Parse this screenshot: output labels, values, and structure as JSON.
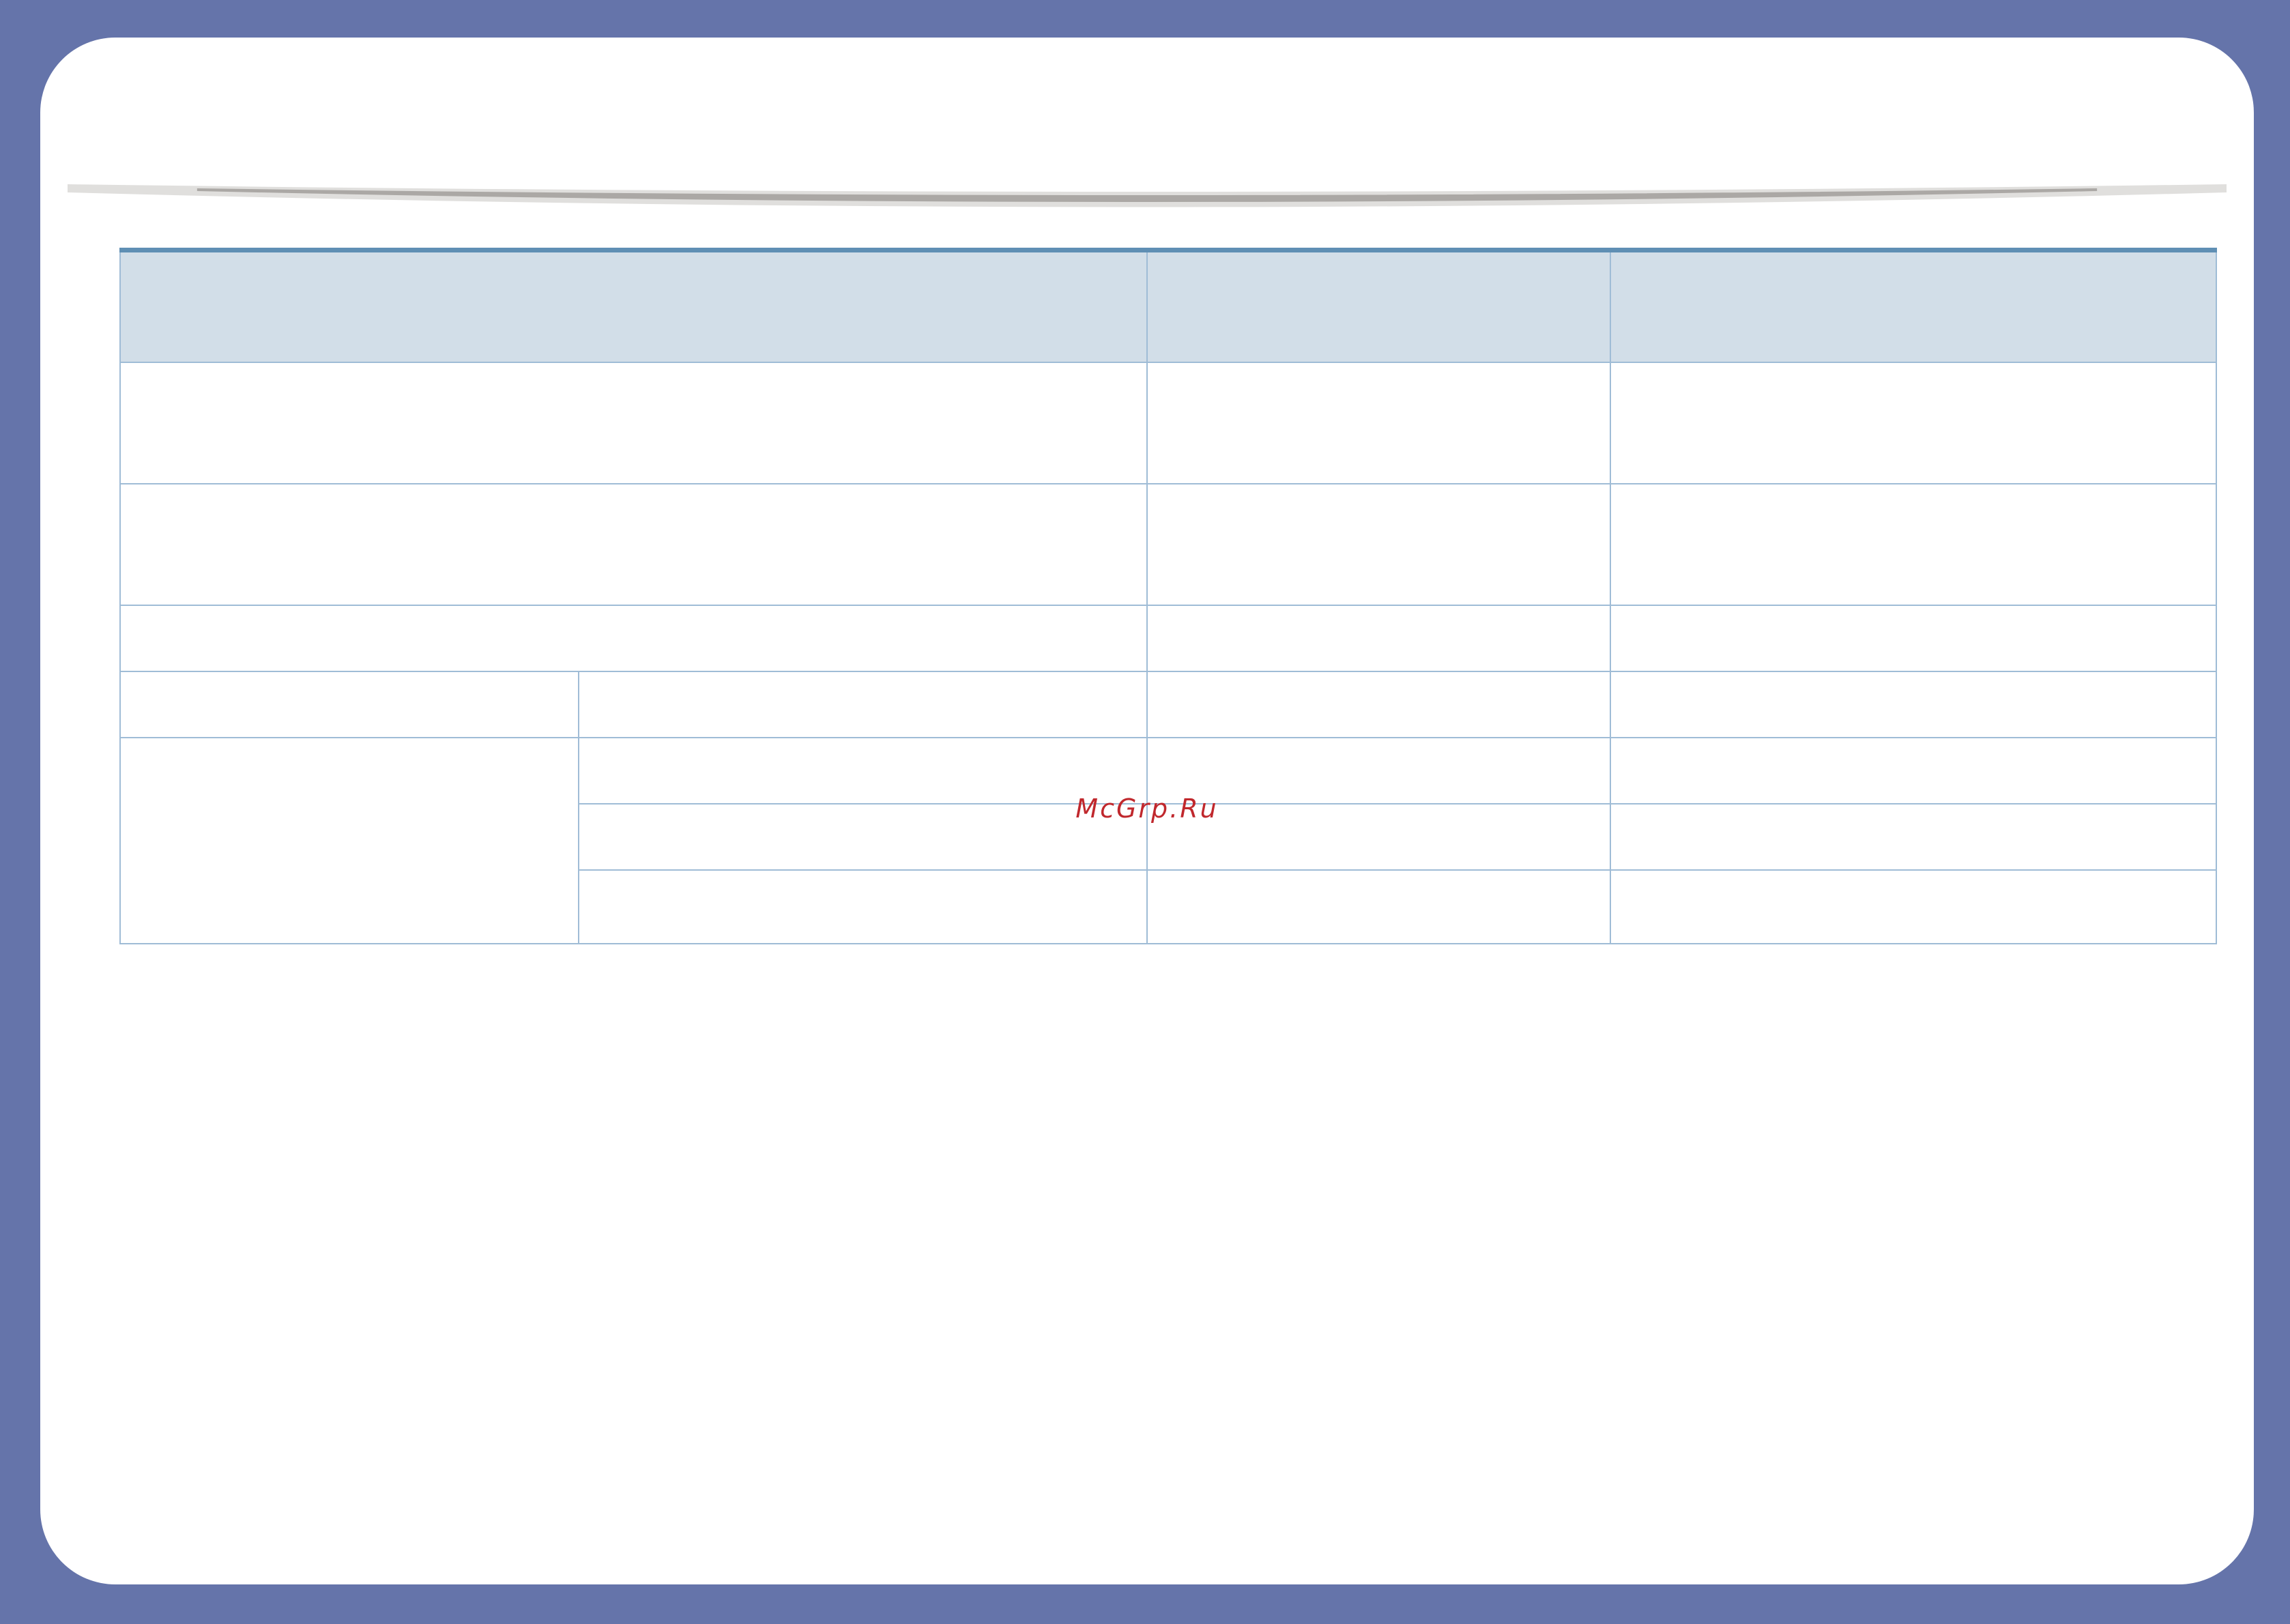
{
  "watermark": {
    "text": "McGrp.Ru"
  },
  "colors": {
    "frame": "#6574aa",
    "page": "#ffffff",
    "table_header_fill": "#d2dee8",
    "table_rule": "#5f8fb4",
    "table_grid": "#9fbcd6",
    "watermark": "#c0282d"
  },
  "table": {
    "header": [
      "",
      "",
      ""
    ],
    "rows": [
      [
        "",
        "",
        ""
      ],
      [
        "",
        "",
        ""
      ],
      [
        "",
        "",
        ""
      ],
      [
        "",
        "",
        "",
        ""
      ],
      [
        "",
        "",
        "",
        ""
      ],
      [
        "",
        "",
        ""
      ],
      [
        "",
        "",
        ""
      ]
    ]
  }
}
